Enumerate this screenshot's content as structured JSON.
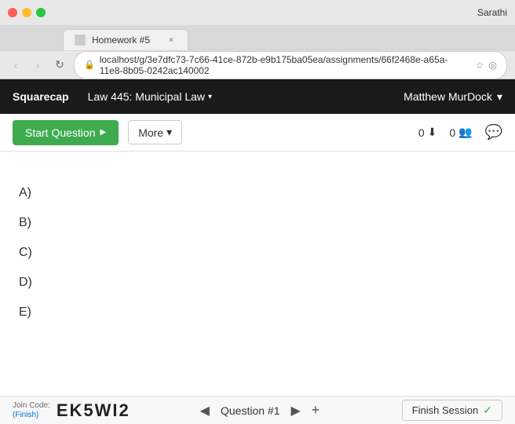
{
  "browser": {
    "title_bar": {
      "profile": "Sarathi"
    },
    "tab": {
      "label": "Homework #5"
    },
    "address_bar": {
      "url": "localhost/g/3e7dfc73-7c66-41ce-872b-e9b175ba05ea/assignments/66f2468e-a65a-11e8-8b05-0242ac140002",
      "nav_back_disabled": true,
      "nav_forward_disabled": true
    }
  },
  "app_header": {
    "logo": "Squarecap",
    "course": "Law 445: Municipal Law",
    "user": "Matthew MurDock"
  },
  "toolbar": {
    "start_question_label": "Start Question",
    "more_label": "More",
    "downloads_count": "0",
    "users_count": "0"
  },
  "answer_options": [
    {
      "label": "A)"
    },
    {
      "label": "B)"
    },
    {
      "label": "C)"
    },
    {
      "label": "D)"
    },
    {
      "label": "E)"
    }
  ],
  "bottom_bar": {
    "join_code_label": "Join Code:",
    "join_code_finish": "(Finish)",
    "join_code_value": "EK5WI2",
    "question_label": "Question #1",
    "finish_session_label": "Finish Session"
  },
  "icons": {
    "play": "▶",
    "dropdown": "▾",
    "chevron_left": "◀",
    "chevron_right": "▶",
    "plus": "+",
    "check": "✓",
    "download": "⬇",
    "users": "👥",
    "chat": "💬"
  }
}
